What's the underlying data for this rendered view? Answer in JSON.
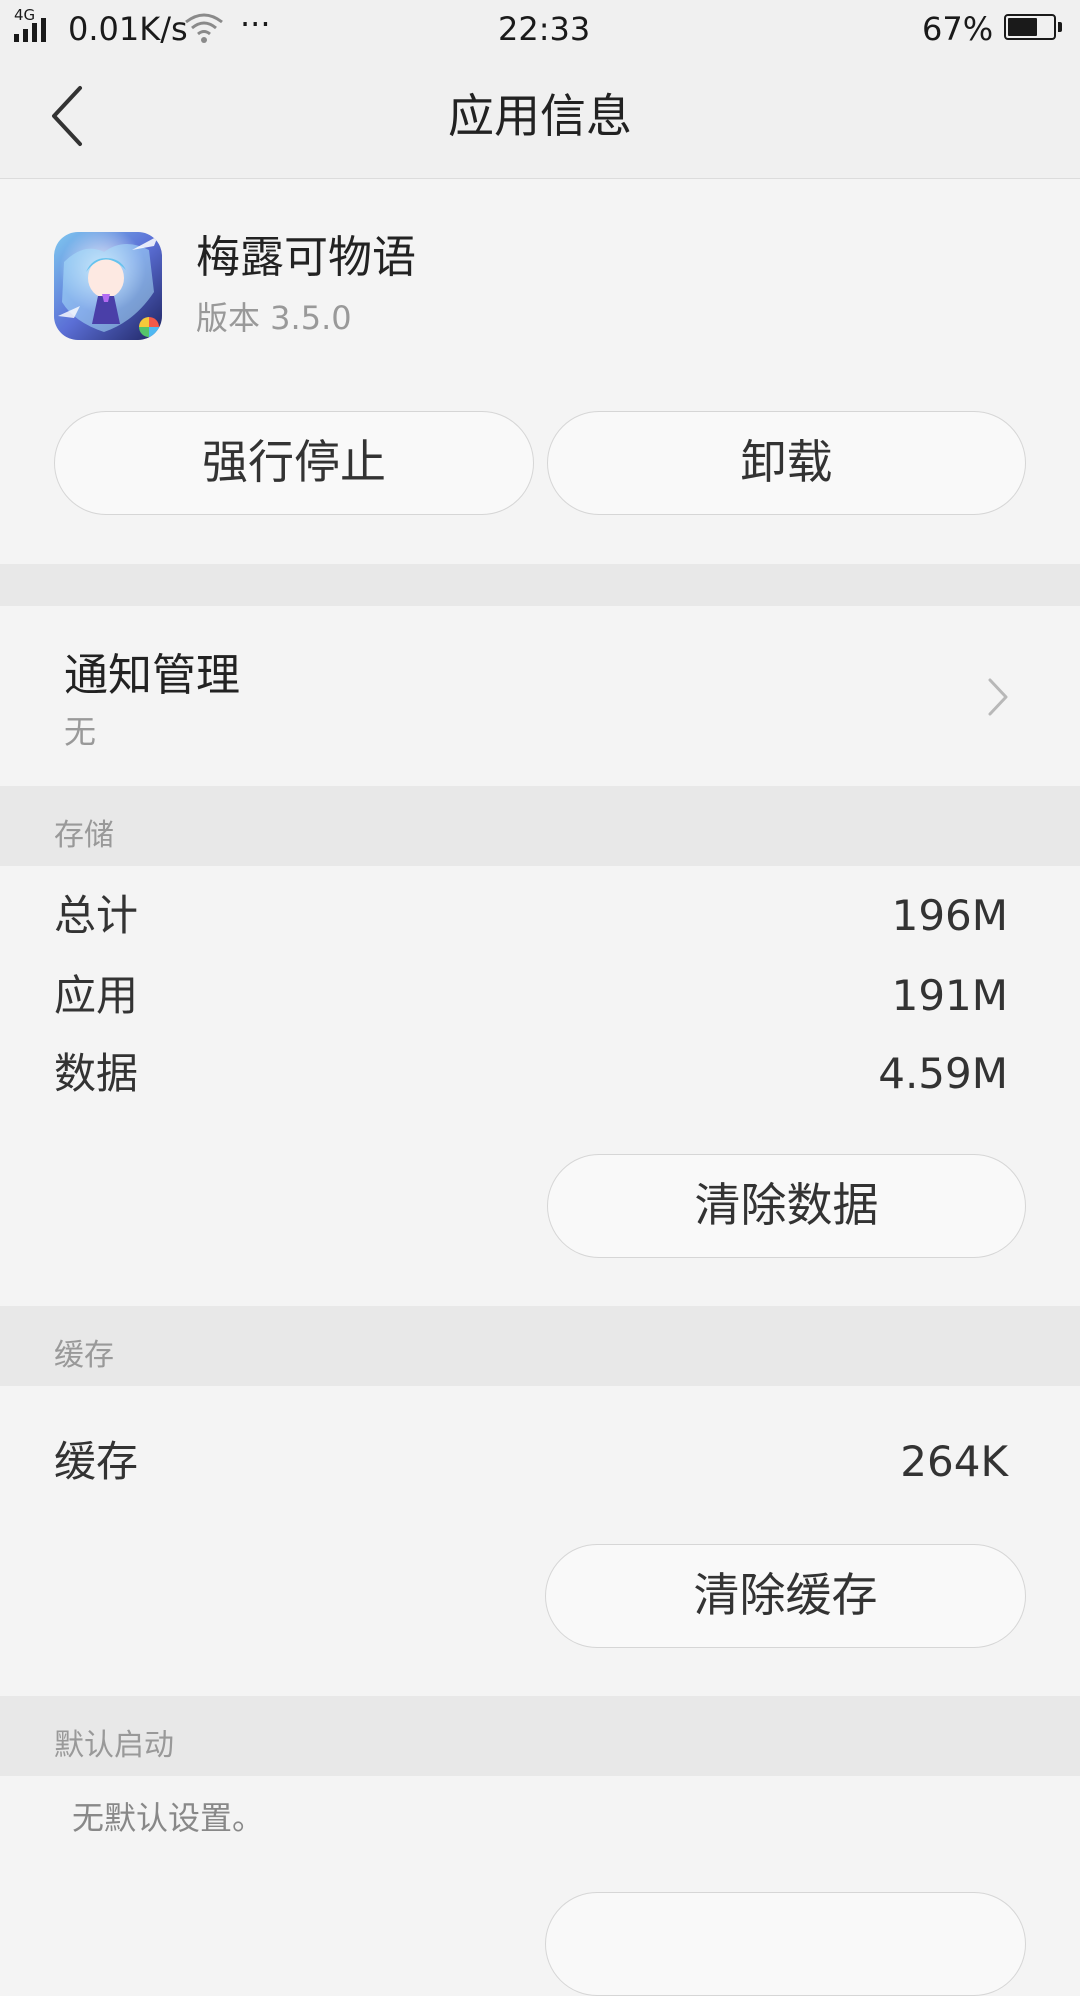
{
  "status_bar": {
    "network": "4G",
    "speed": "0.01K/s",
    "more": "···",
    "time": "22:33",
    "battery": "67%",
    "battery_level": 0.67
  },
  "title_bar": {
    "title": "应用信息"
  },
  "app": {
    "name": "梅露可物语",
    "version": "版本 3.5.0"
  },
  "actions": {
    "force_stop": "强行停止",
    "uninstall": "卸载"
  },
  "notification": {
    "label": "通知管理",
    "value": "无"
  },
  "storage": {
    "header": "存储",
    "rows": [
      {
        "label": "总计",
        "value": "196M"
      },
      {
        "label": "应用",
        "value": "191M"
      },
      {
        "label": "数据",
        "value": "4.59M"
      }
    ],
    "clear_data": "清除数据"
  },
  "cache": {
    "header": "缓存",
    "label": "缓存",
    "value": "264K",
    "clear_cache": "清除缓存"
  },
  "default_launch": {
    "header": "默认启动",
    "text": "无默认设置。"
  },
  "colors": {
    "background": "#f4f4f4",
    "section": "#e8e8e8",
    "text": "#333333",
    "secondary": "#999999"
  }
}
